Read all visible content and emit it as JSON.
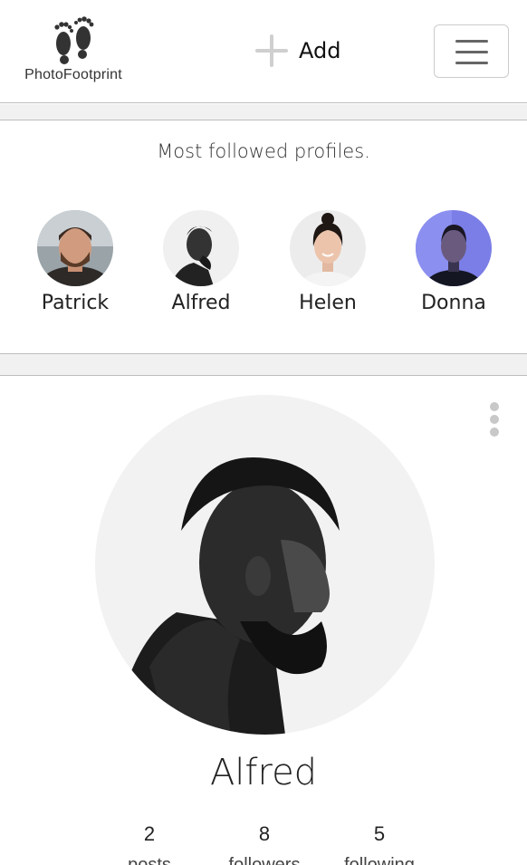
{
  "header": {
    "logo_text": "PhotoFootprint",
    "add_label": "Add"
  },
  "followed": {
    "title": "Most followed profiles.",
    "profiles": [
      {
        "name": "Patrick"
      },
      {
        "name": "Alfred"
      },
      {
        "name": "Helen"
      },
      {
        "name": "Donna"
      }
    ]
  },
  "profile_card": {
    "name": "Alfred",
    "stats": [
      {
        "value": "2",
        "label": "posts"
      },
      {
        "value": "8",
        "label": "followers"
      },
      {
        "value": "5",
        "label": "following"
      }
    ]
  }
}
